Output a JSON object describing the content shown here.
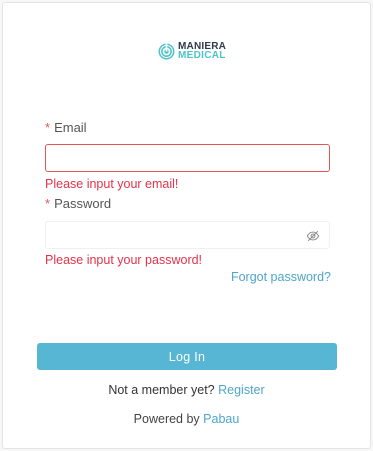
{
  "brand": {
    "line1": "MANIERA",
    "line2": "MEDICAL",
    "accent_color": "#4ec3c9"
  },
  "form": {
    "email": {
      "required_mark": "*",
      "label": "Email",
      "value": "",
      "error": "Please input your email!"
    },
    "password": {
      "required_mark": "*",
      "label": "Password",
      "value": "",
      "error": "Please input your password!",
      "toggle_icon": "eye-slash-icon"
    },
    "forgot_password": "Forgot password?",
    "login_button": "Log In"
  },
  "footer": {
    "member_prompt": "Not a member yet?",
    "register_link": "Register",
    "powered_prefix": "Powered by",
    "powered_brand": "Pabau"
  },
  "colors": {
    "primary": "#58b6d5",
    "link": "#4ea6c9",
    "error": "#e4334b"
  }
}
